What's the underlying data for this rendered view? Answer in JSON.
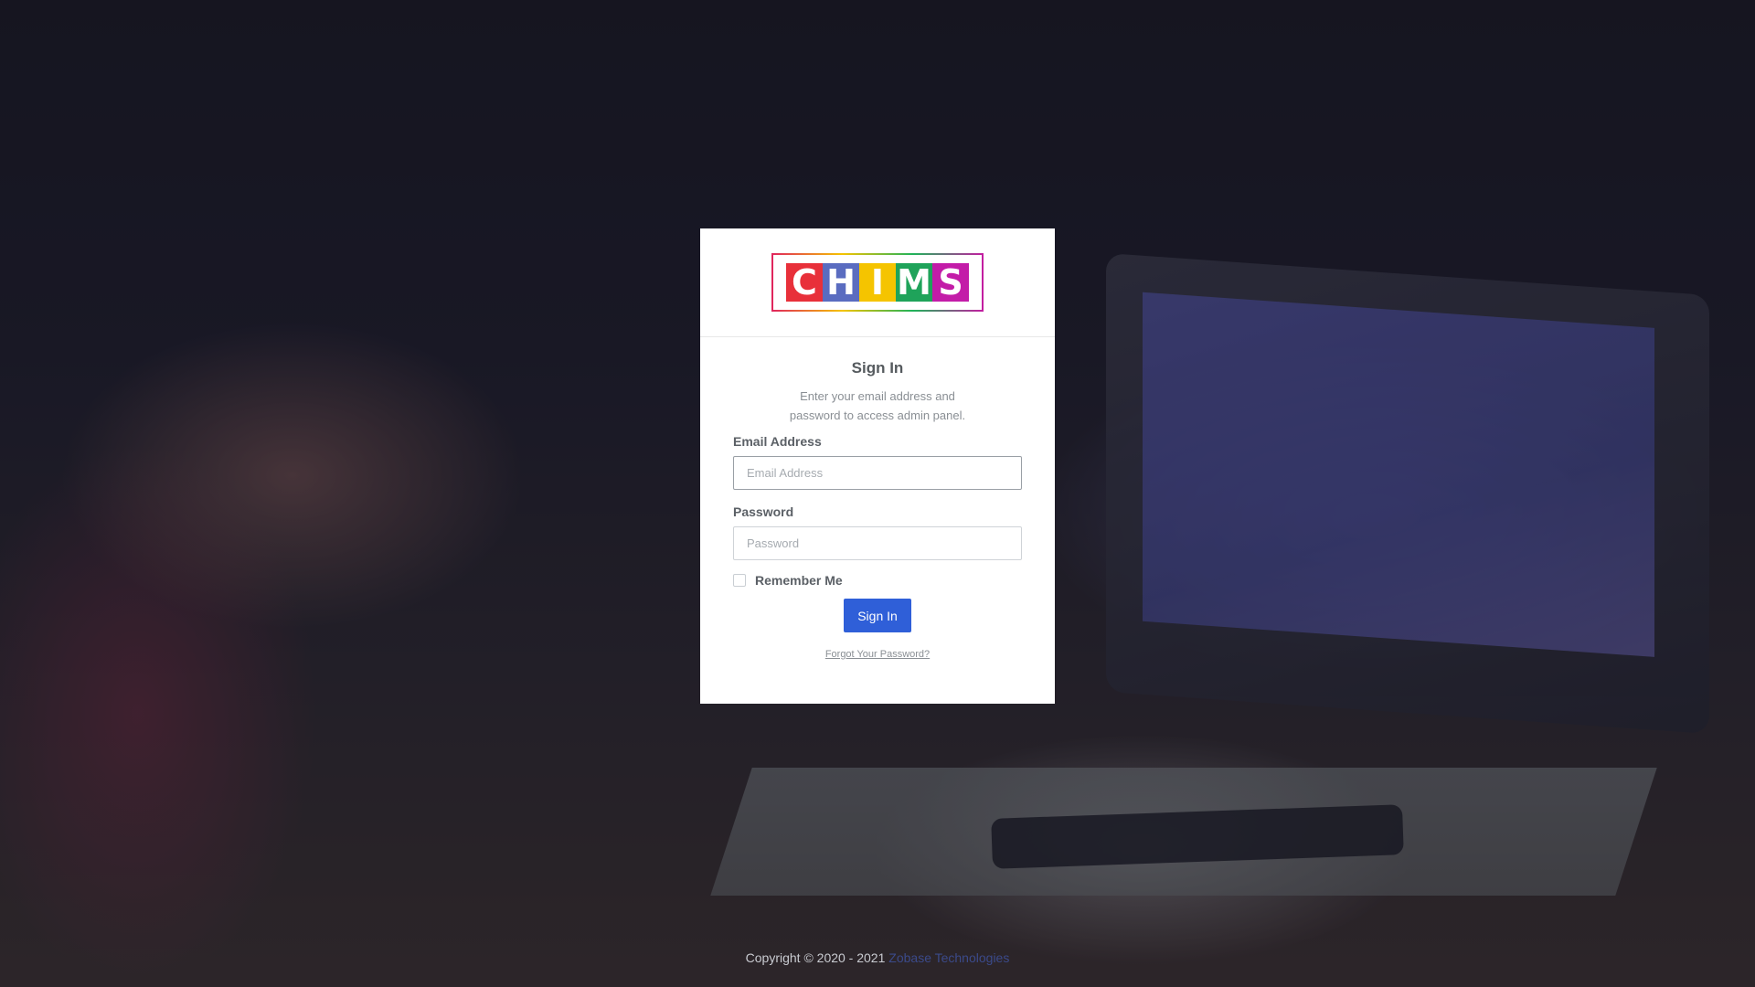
{
  "logo": {
    "letters": [
      "C",
      "H",
      "I",
      "M",
      "S"
    ],
    "letter_colors": [
      "#e8303a",
      "#5a6cc0",
      "#f5c400",
      "#1fa35a",
      "#c31ca8"
    ]
  },
  "signin": {
    "title": "Sign In",
    "subtitle_line1": "Enter your email address and",
    "subtitle_line2": "password to access admin panel.",
    "email_label": "Email Address",
    "email_value": "",
    "email_placeholder": "Email Address",
    "password_label": "Password",
    "password_value": "",
    "password_placeholder": "Password",
    "remember_label": "Remember Me",
    "remember_checked": false,
    "button_label": "Sign In",
    "forgot_label": "Forgot Your Password?"
  },
  "footer": {
    "copyright": "Copyright © 2020 - 2021",
    "company": "Zobase Technologies"
  },
  "colors": {
    "primary_button": "#2f5fd8",
    "card_background": "#ffffff"
  }
}
